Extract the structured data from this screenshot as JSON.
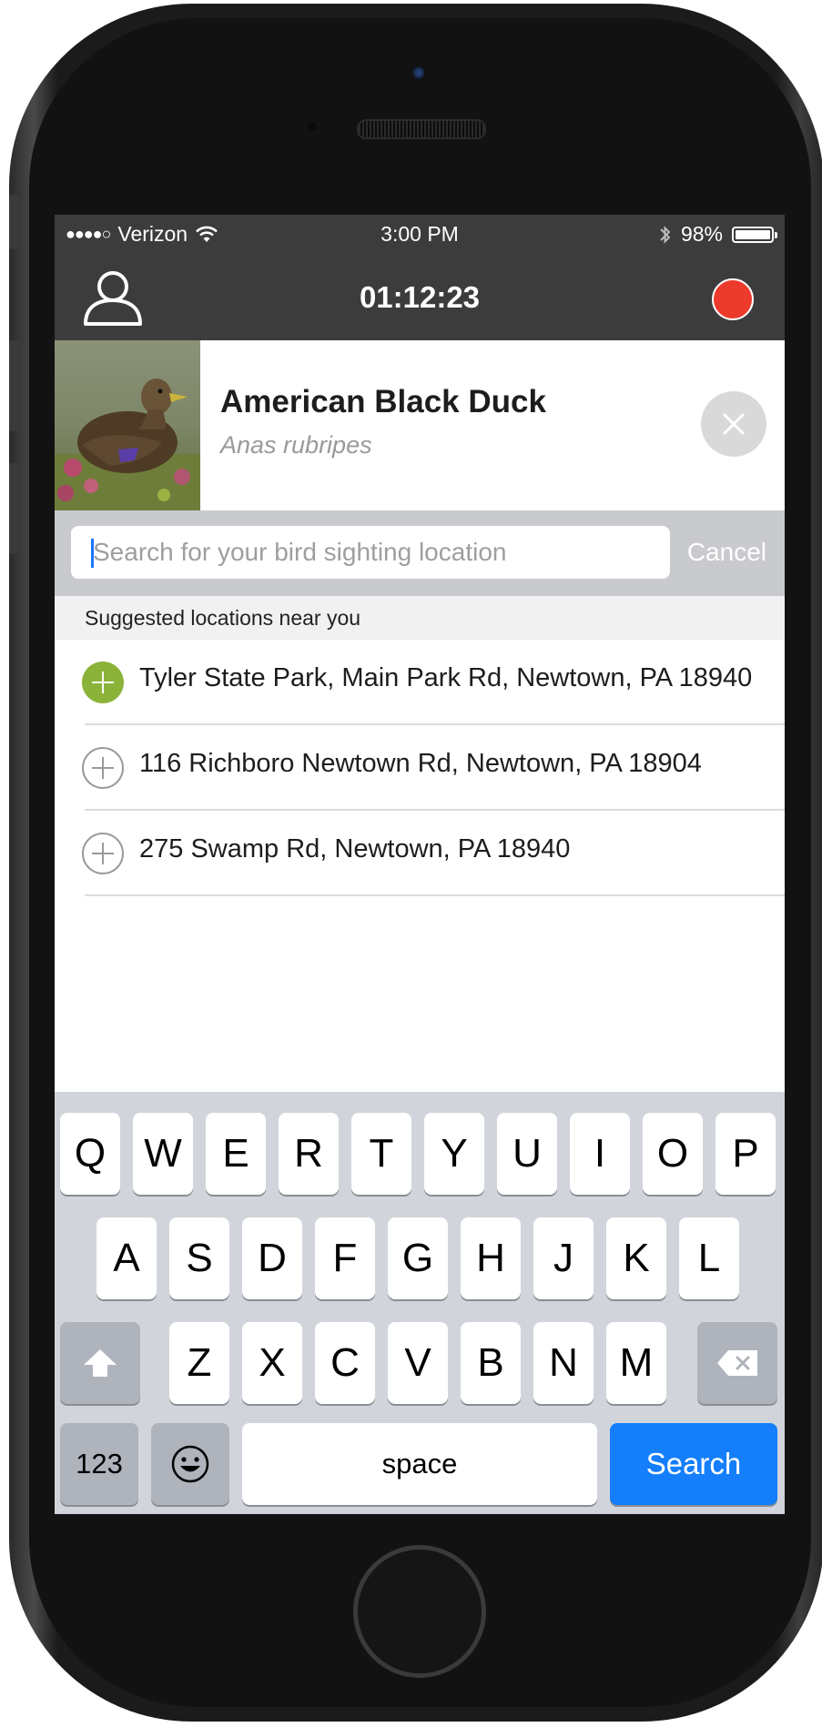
{
  "status_bar": {
    "signal": "●●●●○",
    "carrier": "Verizon",
    "time": "3:00 PM",
    "battery": "98%",
    "battery_fraction": 0.98
  },
  "nav": {
    "timer": "01:12:23"
  },
  "bird": {
    "common_name": "American Black Duck",
    "scientific_name": "Anas rubripes"
  },
  "search": {
    "placeholder": "Search for your bird sighting location",
    "value": "",
    "cancel_label": "Cancel"
  },
  "suggestions": {
    "header": "Suggested locations near you",
    "items": [
      {
        "label": "Tyler State Park, Main Park Rd, Newtown, PA 18940",
        "selected": true
      },
      {
        "label": "116 Richboro Newtown Rd, Newtown, PA 18904",
        "selected": false
      },
      {
        "label": "275 Swamp Rd, Newtown, PA 18940",
        "selected": false
      }
    ]
  },
  "keyboard": {
    "row1": [
      "Q",
      "W",
      "E",
      "R",
      "T",
      "Y",
      "U",
      "I",
      "O",
      "P"
    ],
    "row2": [
      "A",
      "S",
      "D",
      "F",
      "G",
      "H",
      "J",
      "K",
      "L"
    ],
    "row3": [
      "Z",
      "X",
      "C",
      "V",
      "B",
      "N",
      "M"
    ],
    "numbers_label": "123",
    "space_label": "space",
    "search_label": "Search"
  },
  "colors": {
    "record": "#ec3a2c",
    "selected_plus": "#8bb33a",
    "search_key": "#147efb",
    "bars": "#3c3c3c"
  }
}
